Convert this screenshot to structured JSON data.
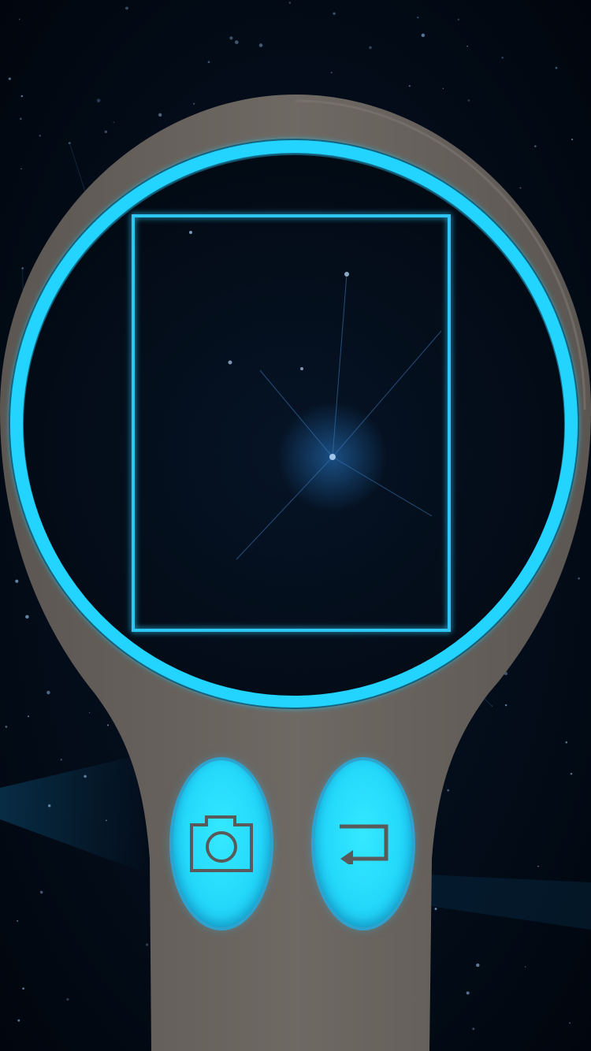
{
  "app": {
    "name": "magnifier-camera-screen"
  },
  "theme": {
    "background": "#020812",
    "body_color": "#6b6560",
    "glow_color": "#22d4ff",
    "button_color": "#25dcff",
    "icon_color": "#5a5a5a"
  },
  "controls": {
    "capture_icon": "camera-icon",
    "switch_icon": "switch-camera-icon"
  }
}
